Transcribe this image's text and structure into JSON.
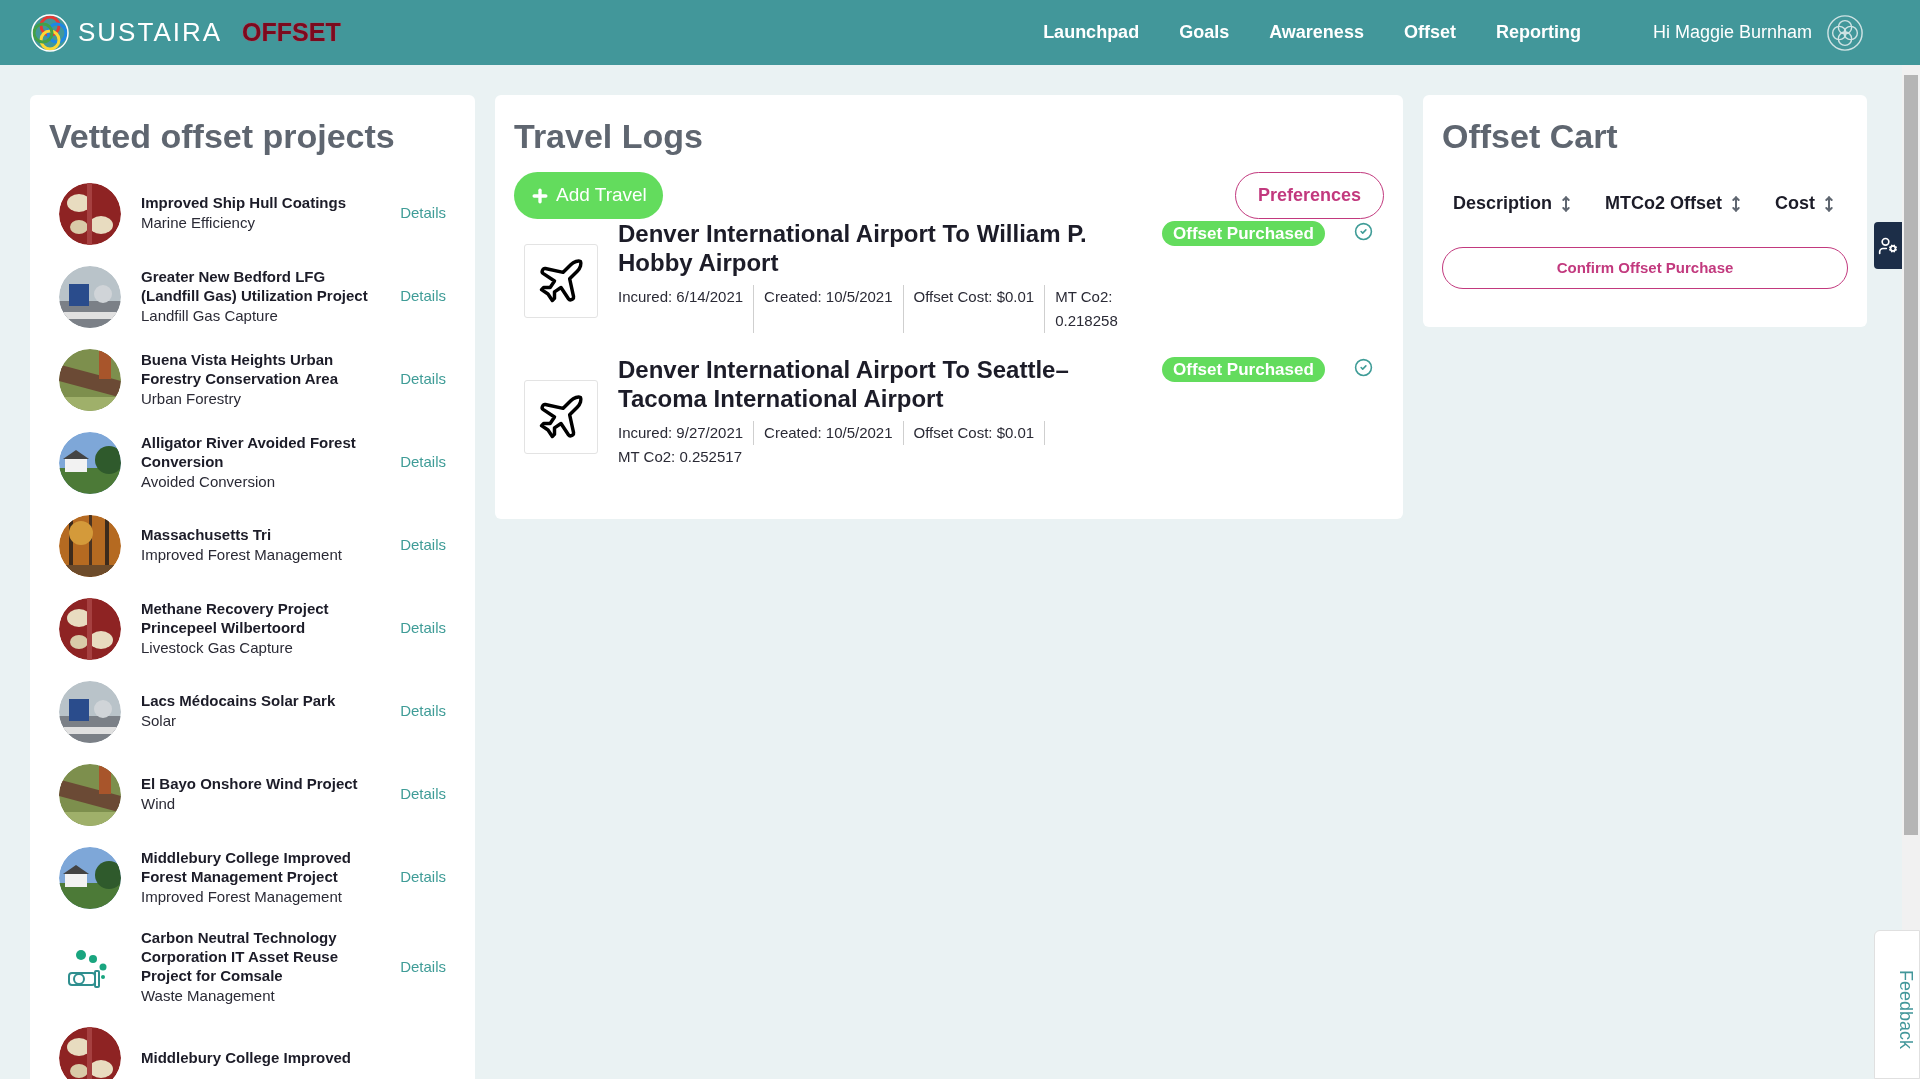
{
  "header": {
    "brand": "SUSTAIRA",
    "product": "OFFSET",
    "nav": [
      {
        "label": "Launchpad",
        "selected": false
      },
      {
        "label": "Goals",
        "selected": false
      },
      {
        "label": "Awareness",
        "selected": false
      },
      {
        "label": "Offset",
        "selected": false
      },
      {
        "label": "Reporting",
        "selected": false
      }
    ],
    "greeting": "Hi Maggie Burnham"
  },
  "projects_panel": {
    "title": "Vetted offset projects",
    "items": [
      {
        "title": "Improved Ship Hull Coatings",
        "category": "Marine Efficiency",
        "link": "Details",
        "kind": "picture"
      },
      {
        "title": "Greater New Bedford LFG (Landfill Gas) Utilization Project",
        "category": "Landfill Gas Capture",
        "link": "Details",
        "kind": "picture"
      },
      {
        "title": "Buena Vista Heights Urban Forestry Conservation Area",
        "category": "Urban Forestry",
        "link": "Details",
        "kind": "picture"
      },
      {
        "title": "Alligator River Avoided Forest Conversion",
        "category": "Avoided Conversion",
        "link": "Details",
        "kind": "picture"
      },
      {
        "title": "Massachusetts Tri",
        "category": "Improved Forest Management",
        "link": "Details",
        "kind": "picture"
      },
      {
        "title": "Methane Recovery Project Princepeel Wilbertoord",
        "category": "Livestock Gas Capture",
        "link": "Details",
        "kind": "picture"
      },
      {
        "title": "Lacs Médocains Solar Park",
        "category": "Solar",
        "link": "Details",
        "kind": "picture"
      },
      {
        "title": "El Bayo Onshore Wind Project",
        "category": "Wind",
        "link": "Details",
        "kind": "picture"
      },
      {
        "title": "Middlebury College Improved Forest Management Project",
        "category": "Improved Forest Management",
        "link": "Details",
        "kind": "picture"
      },
      {
        "title": "Carbon Neutral Technology Corporation IT Asset Reuse Project for Comsale",
        "category": "Waste Management",
        "link": "Details",
        "kind": "icon"
      },
      {
        "title": "Middlebury College Improved",
        "kind": "picture"
      }
    ]
  },
  "travel_logs": {
    "title": "Travel Logs",
    "add_button": "Add Travel",
    "preferences_button": "Preferences",
    "entries": [
      {
        "title": "Denver International Airport To William P. Hobby Airport",
        "status": "Offset Purchased",
        "details": [
          "Incured: 6/14/2021",
          "Created: 10/5/2021",
          "Offset Cost: $0.01",
          "MT Co2: 0.218258"
        ]
      },
      {
        "title": "Denver International Airport To Seattle–Tacoma International Airport",
        "status": "Offset Purchased",
        "details": [
          "Incured: 9/27/2021",
          "Created: 10/5/2021",
          "Offset Cost: $0.01",
          "MT Co2: 0.252517"
        ]
      }
    ]
  },
  "offset_cart": {
    "title": "Offset Cart",
    "columns": [
      "Description",
      "MTCo2 Offset",
      "Cost"
    ],
    "confirm_button": "Confirm Offset Purchase"
  },
  "feedback_tab": "Feedback"
}
